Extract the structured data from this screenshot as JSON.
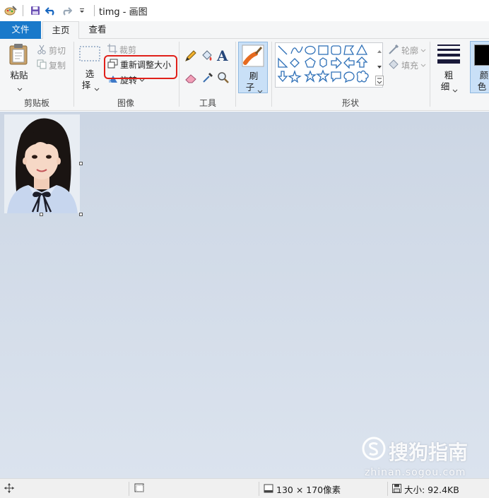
{
  "window": {
    "title": "timg - 画图"
  },
  "menu": {
    "file": "文件",
    "home": "主页",
    "view": "查看"
  },
  "clipboard": {
    "paste": "粘贴",
    "cut": "剪切",
    "copy": "复制",
    "group": "剪贴板"
  },
  "image": {
    "select_top": "选",
    "select_bottom": "择",
    "crop": "裁剪",
    "resize": "重新调整大小",
    "rotate": "旋转",
    "group": "图像"
  },
  "tools": {
    "group": "工具",
    "text_icon_glyph": "A"
  },
  "brushes": {
    "top": "刷",
    "bottom": "子"
  },
  "shapes": {
    "outline": "轮廓",
    "fill": "填充",
    "group": "形状"
  },
  "size": {
    "top": "粗",
    "bottom": "细"
  },
  "color": {
    "top": "颜",
    "bottom": "色",
    "color1": "#000000"
  },
  "status": {
    "dimensions": "130 × 170像素",
    "file_size": "大小: 92.4KB"
  },
  "watermark": {
    "brand": "搜狗指南",
    "url": "zhinan.sogou.com"
  },
  "colors": {
    "accent": "#1979ca",
    "highlight": "#e0201a"
  }
}
